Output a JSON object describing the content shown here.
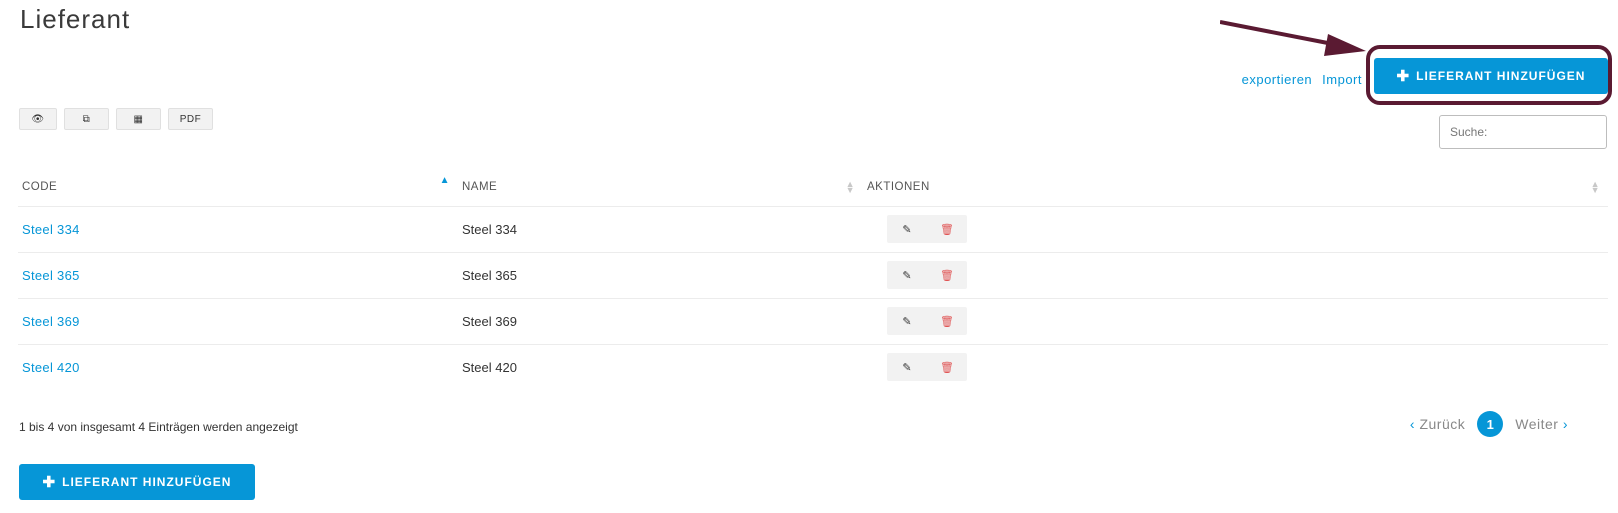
{
  "page": {
    "title": "Lieferant"
  },
  "header_links": {
    "export": "exportieren",
    "import": "Import"
  },
  "add_button": {
    "plus": "✚",
    "label": "LIEFERANT HINZUFÜGEN"
  },
  "toolbar": {
    "view_icon": "👁",
    "copy_icon": "⧉",
    "table_icon": "▦",
    "pdf": "PDF"
  },
  "search": {
    "placeholder": "Suche:"
  },
  "table": {
    "headers": {
      "code": "CODE",
      "name": "NAME",
      "actions": "AKTIONEN"
    },
    "rows": [
      {
        "code": "Steel 334",
        "name": "Steel 334"
      },
      {
        "code": "Steel 365",
        "name": "Steel 365"
      },
      {
        "code": "Steel 369",
        "name": "Steel 369"
      },
      {
        "code": "Steel 420",
        "name": "Steel 420"
      }
    ],
    "row_icons": {
      "edit": "✎",
      "delete": "🗑"
    }
  },
  "info_text": "1 bis 4 von insgesamt 4 Einträgen werden angezeigt",
  "pagination": {
    "prev": "Zurück",
    "next": "Weiter",
    "current": "1",
    "prev_chev": "‹",
    "next_chev": "›"
  },
  "colors": {
    "accent": "#0696d7",
    "highlight": "#5a1a32",
    "delete": "#e05555"
  }
}
